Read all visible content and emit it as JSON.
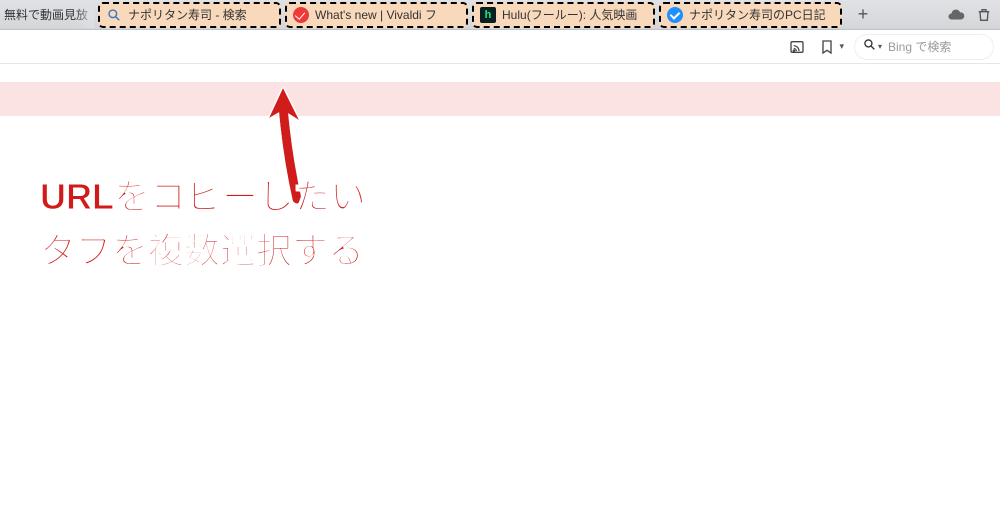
{
  "tabs": [
    {
      "label": "無料で動画見放"
    },
    {
      "label": "ナポリタン寿司 - 検索"
    },
    {
      "label": "What's new | Vivaldi フ"
    },
    {
      "label": "Hulu(フールー): 人気映画"
    },
    {
      "label": "ナポリタン寿司のPC日記"
    }
  ],
  "new_tab_label": "+",
  "search": {
    "placeholder": "Bing で検索"
  },
  "caption": {
    "line1": "URLをコピーしたい",
    "line2": "タブを複数選択する"
  },
  "colors": {
    "selection_bg": "#f8d9bc",
    "accent_red": "#d11a1a",
    "pink_band": "#fbe3e3"
  }
}
